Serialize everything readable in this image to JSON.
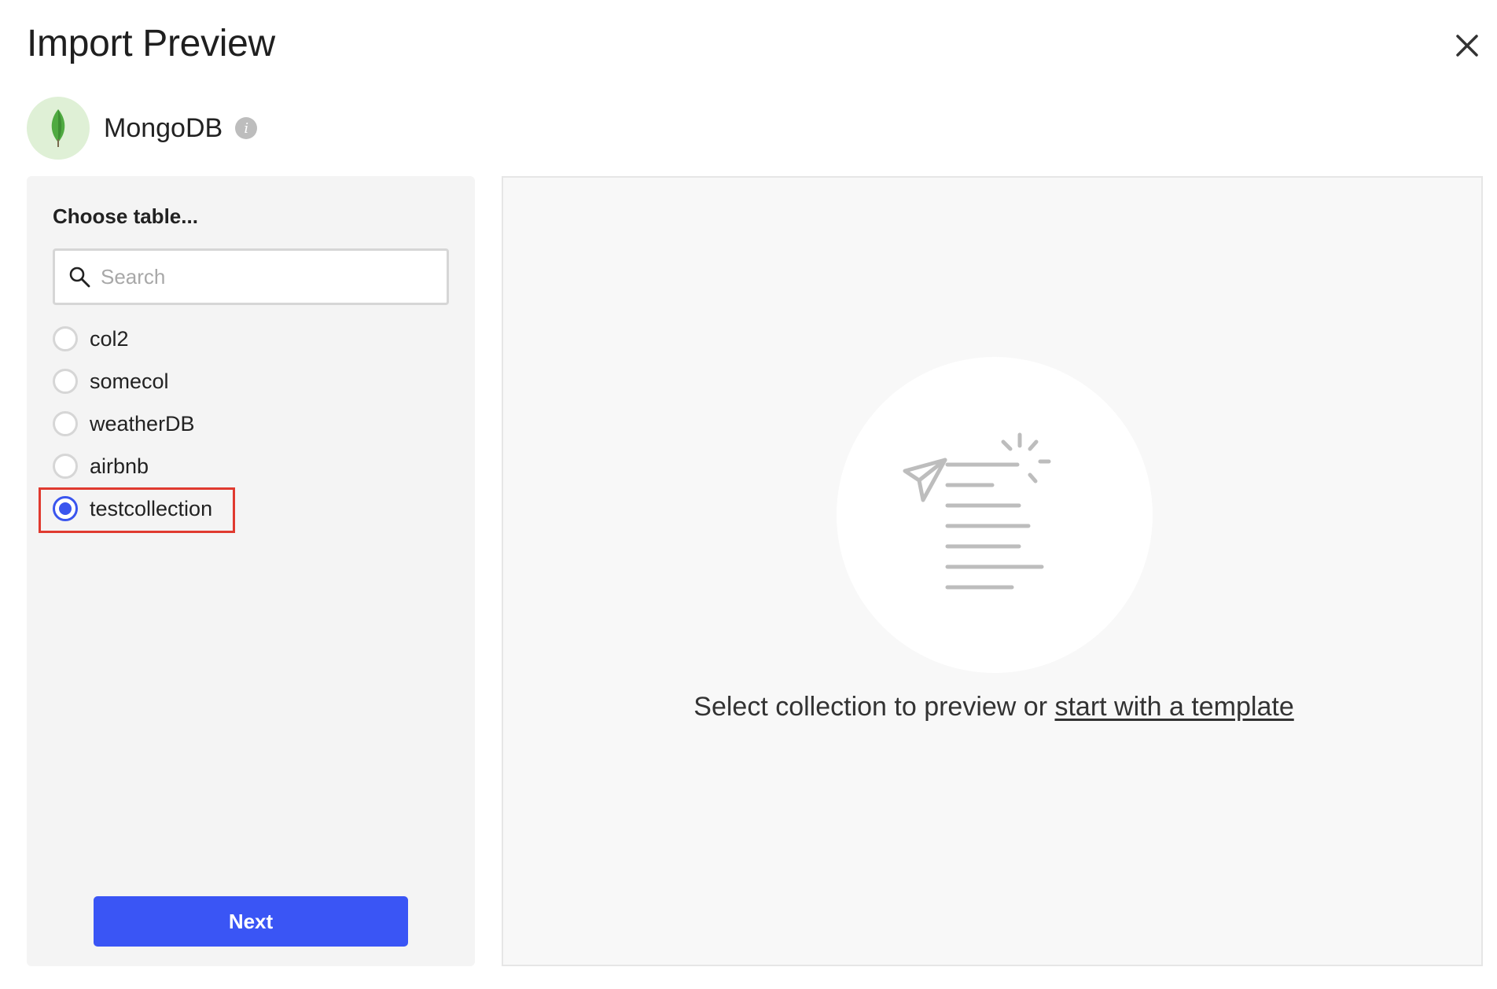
{
  "header": {
    "title": "Import Preview",
    "close_icon": "close-icon"
  },
  "source": {
    "name": "MongoDB",
    "logo_icon": "mongodb-leaf-icon",
    "info_icon": "info-icon",
    "info_glyph": "i"
  },
  "left_panel": {
    "choose_label": "Choose table...",
    "search": {
      "placeholder": "Search",
      "value": "",
      "icon": "search-icon"
    },
    "tables": [
      {
        "label": "col2",
        "selected": false
      },
      {
        "label": "somecol",
        "selected": false
      },
      {
        "label": "weatherDB",
        "selected": false
      },
      {
        "label": "airbnb",
        "selected": false
      },
      {
        "label": "testcollection",
        "selected": true
      }
    ],
    "next_label": "Next"
  },
  "preview": {
    "illustration_icon": "document-send-icon",
    "message_prefix": "Select collection to preview or ",
    "template_link": "start with a template"
  },
  "colors": {
    "accent": "#3a55f5",
    "highlight": "#e03a2f",
    "mongo_green": "#4faa41",
    "logo_bg": "#dff0d6"
  }
}
